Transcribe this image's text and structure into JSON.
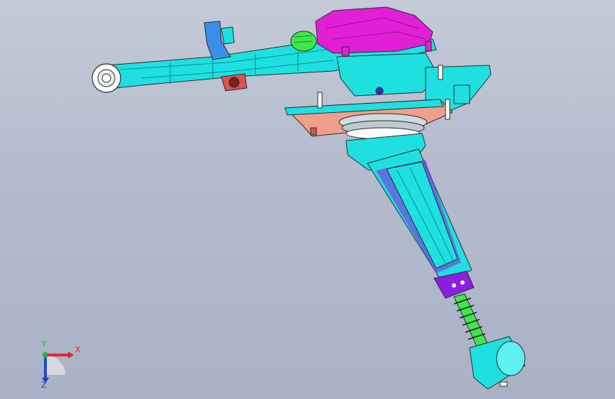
{
  "app": {
    "view": "3d-model-viewport"
  },
  "triad": {
    "x_label": "X",
    "y_label": "Y",
    "z_label": "Z",
    "x_color": "#e3262a",
    "y_color": "#1eb43c",
    "z_color": "#2046c8"
  },
  "colors": {
    "background_top": "#c5cad8",
    "background_bottom": "#a9b2c6",
    "cyan_part": "#1fe0e0",
    "magenta_part": "#e21fd6",
    "purple_part": "#8a1ee0",
    "salmon_part": "#f0a08a",
    "green_part": "#3fe84a",
    "blue_part": "#3a8fe8",
    "outline": "#2a2a2a"
  },
  "icons": [
    "axis-triad-icon"
  ]
}
